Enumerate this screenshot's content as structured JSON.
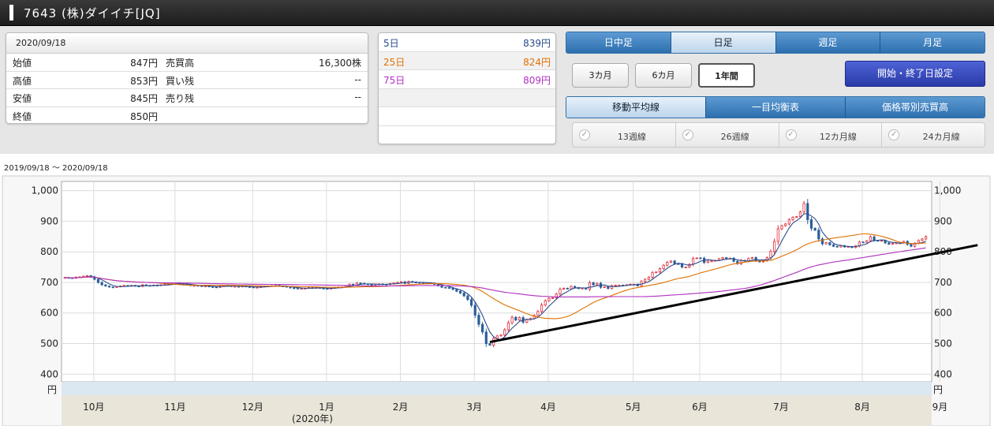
{
  "header": {
    "title": "7643 (株)ダイイチ[JQ]"
  },
  "price_panel": {
    "date": "2020/09/18",
    "rows": [
      {
        "l1": "始値",
        "v1": "847円",
        "l2": "売買高",
        "v2": "16,300株"
      },
      {
        "l1": "高値",
        "v1": "853円",
        "l2": "買い残",
        "v2": "--"
      },
      {
        "l1": "安値",
        "v1": "845円",
        "l2": "売り残",
        "v2": "--"
      },
      {
        "l1": "終値",
        "v1": "850円",
        "l2": "",
        "v2": ""
      }
    ]
  },
  "ma_panel": [
    {
      "label": "5日",
      "value": "839円",
      "color": "#2b4b8c"
    },
    {
      "label": "25日",
      "value": "824円",
      "color": "#e07000"
    },
    {
      "label": "75日",
      "value": "809円",
      "color": "#b030c0"
    },
    {
      "label": "",
      "value": "",
      "color": "#222"
    },
    {
      "label": "",
      "value": "",
      "color": "#222"
    }
  ],
  "period_tabs": [
    "日中足",
    "日足",
    "週足",
    "月足"
  ],
  "period_selected": 1,
  "range_buttons": [
    "3カ月",
    "6カ月",
    "1年間"
  ],
  "range_selected": 2,
  "date_setting_button": "開始・終了日設定",
  "indicator_tabs": [
    "移動平均線",
    "一目均衡表",
    "価格帯別売買高"
  ],
  "indicator_selected": 0,
  "checkboxes": [
    "13週線",
    "26週線",
    "12カ月線",
    "24カ月線"
  ],
  "date_range": "2019/09/18 〜 2020/09/18",
  "chart_data": {
    "type": "candlestick",
    "y_ticks": [
      "1,000",
      "900",
      "800",
      "700",
      "600",
      "500",
      "400"
    ],
    "y_tick_values": [
      1000,
      900,
      800,
      700,
      600,
      500,
      400
    ],
    "ylim": [
      375,
      1030
    ],
    "yunit": "円",
    "month_labels": [
      "10月",
      "11月",
      "12月",
      "1月",
      "2月",
      "3月",
      "4月",
      "5月",
      "6月",
      "7月",
      "8月",
      "9月"
    ],
    "year_label": "(2020年)",
    "colors": {
      "up": "#e0303c",
      "down": "#2b5f9a",
      "ma5": "#2b4b8c",
      "ma25": "#e07000",
      "ma75": "#b030c0",
      "trend": "#000000"
    },
    "close": [
      716,
      715,
      714,
      717,
      718,
      720,
      722,
      718,
      710,
      700,
      692,
      688,
      685,
      684,
      686,
      688,
      690,
      689,
      690,
      688,
      687,
      692,
      690,
      689,
      691,
      690,
      692,
      693,
      694,
      696,
      698,
      695,
      694,
      692,
      690,
      690,
      689,
      688,
      688,
      686,
      685,
      684,
      688,
      690,
      689,
      687,
      687,
      686,
      688,
      686,
      685,
      683,
      684,
      686,
      688,
      688,
      689,
      690,
      688,
      687,
      685,
      682,
      681,
      680,
      680,
      681,
      683,
      682,
      683,
      681,
      680,
      679,
      681,
      684,
      685,
      685,
      689,
      694,
      691,
      698,
      697,
      695,
      693,
      692,
      694,
      695,
      694,
      693,
      696,
      698,
      700,
      702,
      697,
      703,
      701,
      700,
      699,
      698,
      698,
      697,
      694,
      689,
      684,
      683,
      682,
      677,
      671,
      665,
      656,
      644,
      625,
      593,
      563,
      538,
      500,
      495,
      517,
      525,
      528,
      545,
      568,
      586,
      577,
      585,
      570,
      578,
      582,
      592,
      605,
      626,
      640,
      648,
      650,
      662,
      678,
      681,
      679,
      687,
      683,
      680,
      681,
      678,
      699,
      692,
      697,
      684,
      686,
      680,
      689,
      691,
      691,
      690,
      692,
      694,
      694,
      689,
      703,
      710,
      717,
      732,
      734,
      745,
      756,
      766,
      770,
      761,
      760,
      750,
      750,
      759,
      778,
      780,
      779,
      765,
      770,
      770,
      772,
      777,
      781,
      778,
      779,
      769,
      761,
      772,
      770,
      778,
      781,
      771,
      767,
      771,
      781,
      801,
      834,
      875,
      885,
      891,
      905,
      913,
      915,
      930,
      958,
      905,
      877,
      871,
      842,
      826,
      830,
      823,
      818,
      816,
      820,
      816,
      817,
      814,
      819,
      832,
      831,
      836,
      849,
      837,
      836,
      837,
      829,
      825,
      828,
      829,
      829,
      834,
      824,
      818,
      828,
      837,
      842,
      850
    ]
  }
}
